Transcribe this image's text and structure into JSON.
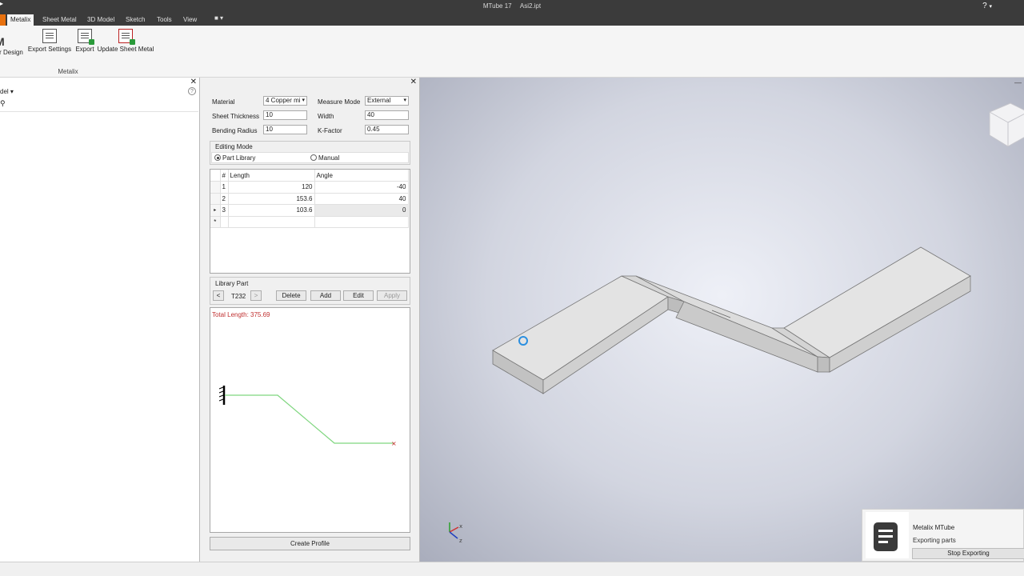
{
  "titlebar": {
    "app": "MTube 17",
    "file": "Asi2.ipt",
    "help": "?"
  },
  "tabs": [
    "Metalix",
    "Sheet Metal",
    "3D Model",
    "Sketch",
    "Tools",
    "View"
  ],
  "ribbon": {
    "buttons": [
      "r Design",
      "Export Settings",
      "Export",
      "Update Sheet Metal"
    ],
    "group_label": "Metalix"
  },
  "left_panel": {
    "header": "del"
  },
  "form": {
    "material_label": "Material",
    "material_value": "4 Copper mi",
    "measure_mode_label": "Measure Mode",
    "measure_mode_value": "External",
    "sheet_thickness_label": "Sheet Thickness",
    "sheet_thickness_value": "10",
    "width_label": "Width",
    "width_value": "40",
    "bending_radius_label": "Bending Radius",
    "bending_radius_value": "10",
    "kfactor_label": "K-Factor",
    "kfactor_value": "0.45"
  },
  "editing_mode": {
    "title": "Editing Mode",
    "option_library": "Part Library",
    "option_manual": "Manual"
  },
  "grid": {
    "headers": [
      "#",
      "Length",
      "Angle"
    ],
    "rows": [
      {
        "n": "1",
        "length": "120",
        "angle": "-40"
      },
      {
        "n": "2",
        "length": "153.6",
        "angle": "40"
      },
      {
        "n": "3",
        "length": "103.6",
        "angle": "0"
      }
    ],
    "new_row_marker": "*"
  },
  "library_part": {
    "title": "Library Part",
    "prev": "<",
    "next": ">",
    "code": "T232",
    "delete": "Delete",
    "add": "Add",
    "edit": "Edit",
    "apply": "Apply"
  },
  "drawing": {
    "total_length": "Total Length: 375.69"
  },
  "create_profile": "Create Profile",
  "toast": {
    "title": "Metalix MTube",
    "message": "Exporting parts",
    "stop": "Stop Exporting"
  },
  "colors": {
    "accent": "#e8710e",
    "profile_line": "#7fd67f",
    "total_text": "#c03030"
  }
}
